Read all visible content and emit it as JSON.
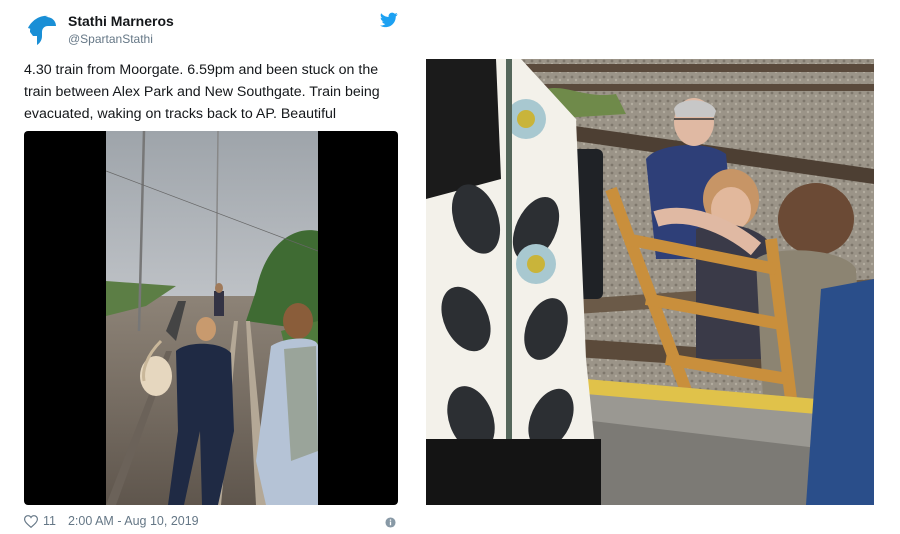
{
  "tweet": {
    "author_name": "Stathi Marneros",
    "author_handle": "@SpartanStathi",
    "text": "4.30 train from Moorgate. 6.59pm and been stuck on the train between Alex Park and New Southgate. Train being evacuated, waking on tracks back to AP. Beautiful",
    "likes": "11",
    "timestamp": "2:00 AM - Aug 10, 2019",
    "icons": {
      "avatar": "spartan-helmet-icon",
      "brand": "twitter-bird-icon",
      "like": "heart-icon",
      "info": "info-icon"
    },
    "colors": {
      "brand": "#1da1f2",
      "avatar": "#1a8fd6",
      "muted": "#657786"
    }
  }
}
